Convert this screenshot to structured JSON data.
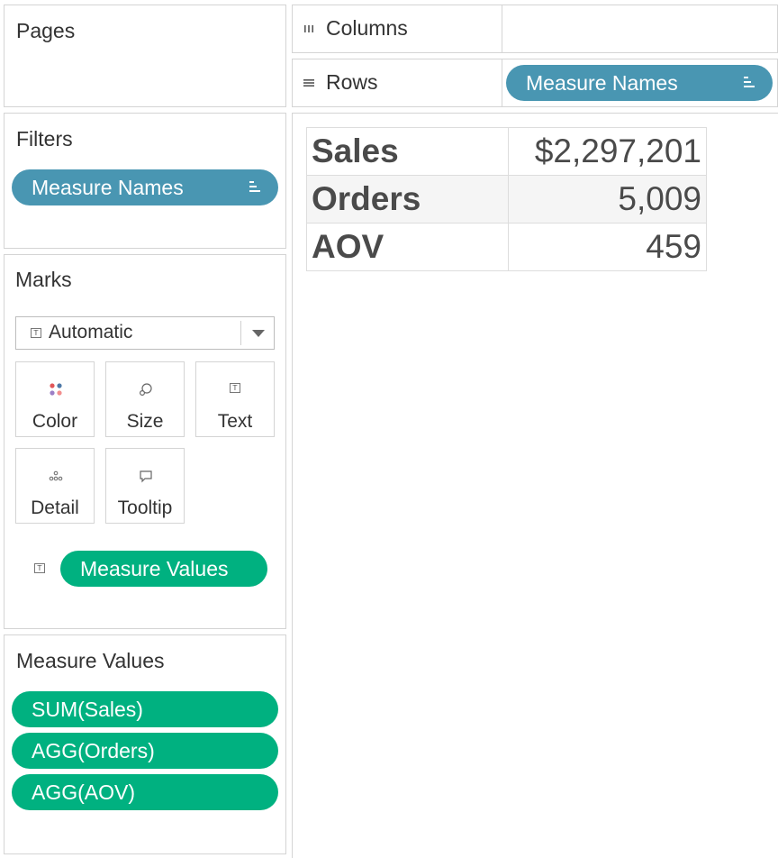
{
  "pages": {
    "title": "Pages"
  },
  "filters": {
    "title": "Filters",
    "pills": [
      {
        "label": "Measure Names"
      }
    ]
  },
  "marks": {
    "title": "Marks",
    "mark_type": "Automatic",
    "buttons": {
      "color": "Color",
      "size": "Size",
      "text": "Text",
      "detail": "Detail",
      "tooltip": "Tooltip"
    },
    "text_field": "Measure Values"
  },
  "measure_values_card": {
    "title": "Measure Values",
    "pills": [
      {
        "label": "SUM(Sales)"
      },
      {
        "label": "AGG(Orders)"
      },
      {
        "label": "AGG(AOV)"
      }
    ]
  },
  "shelves": {
    "columns": {
      "label": "Columns",
      "pills": []
    },
    "rows": {
      "label": "Rows",
      "pills": [
        {
          "label": "Measure Names"
        }
      ]
    }
  },
  "view": {
    "rows": [
      {
        "header": "Sales",
        "value": "$2,297,201"
      },
      {
        "header": "Orders",
        "value": "5,009"
      },
      {
        "header": "AOV",
        "value": "459"
      }
    ]
  },
  "colors": {
    "dimension_pill": "#4996b2",
    "measure_pill": "#00b180"
  },
  "icons": {
    "columns_shelf": "columns-icon",
    "rows_shelf": "rows-icon",
    "pill_sort": "sort-icon",
    "mark_type": "text-mark-icon"
  }
}
